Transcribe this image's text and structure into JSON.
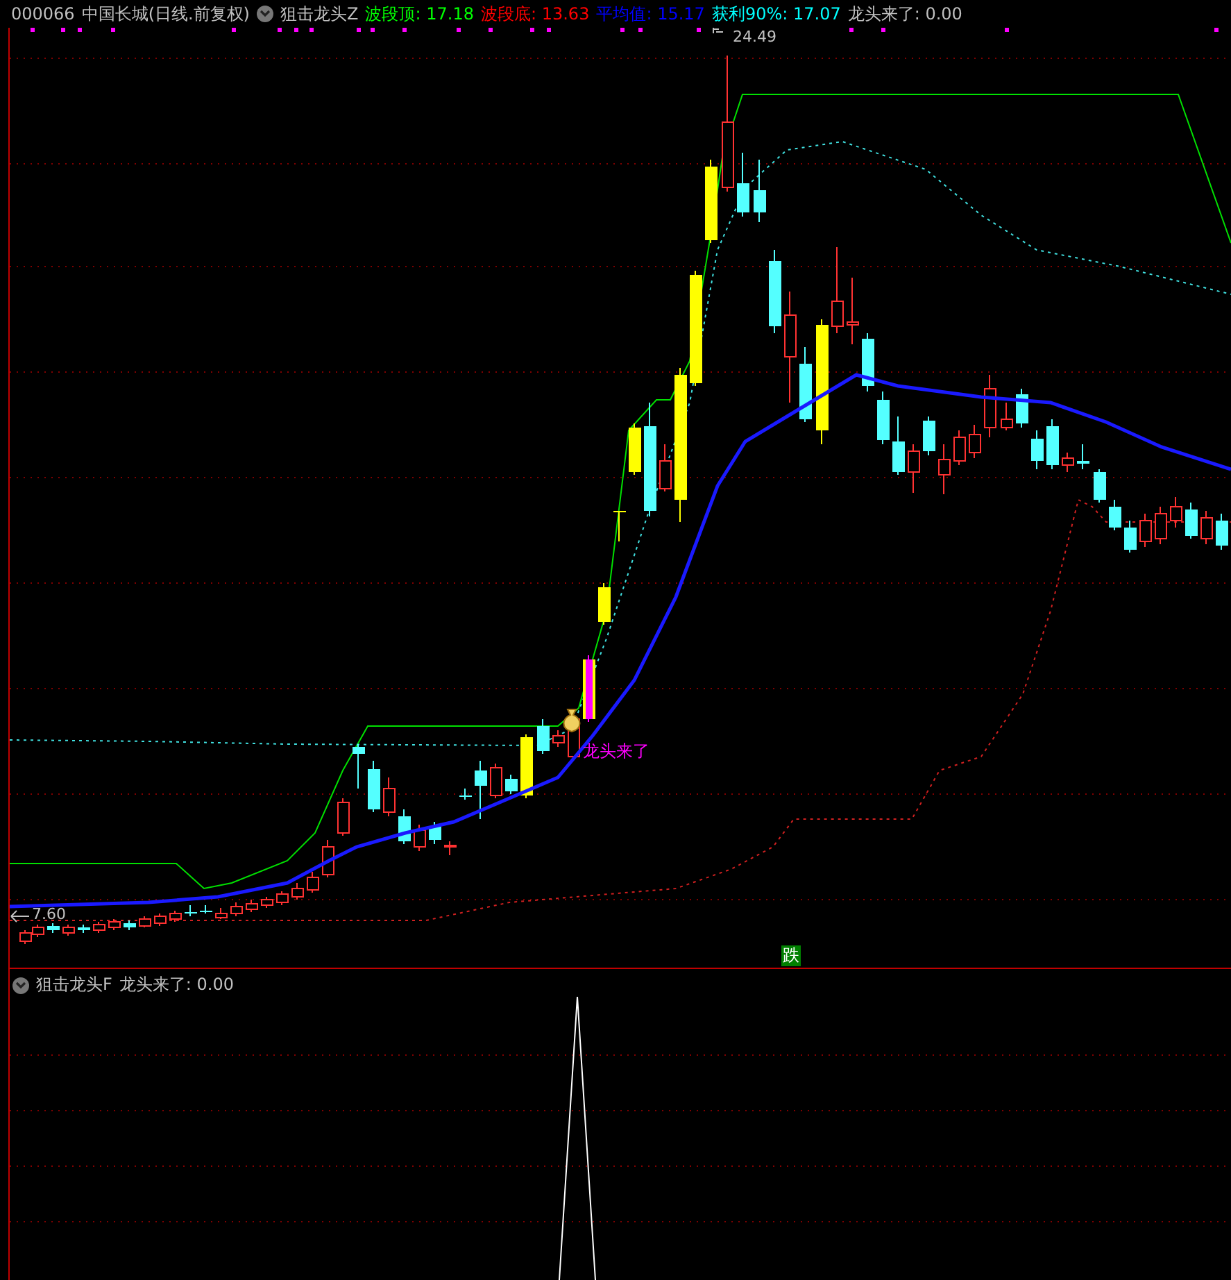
{
  "header": {
    "code": "000066",
    "name": "中国长城(日线.前复权)",
    "indicator": "狙击龙头Z",
    "values": [
      {
        "label": "波段顶:",
        "value": "17.18",
        "color": "#00ff00"
      },
      {
        "label": "波段底:",
        "value": "13.63",
        "color": "#ff0000"
      },
      {
        "label": "平均值:",
        "value": "15.17",
        "color": "#0000ff"
      },
      {
        "label": "获利90%:",
        "value": "17.07",
        "color": "#00ffff"
      },
      {
        "label": "龙头来了:",
        "value": "0.00",
        "color": "#c0c0c0"
      }
    ]
  },
  "main_chart": {
    "high_label": "24.49",
    "low_label": "7.60",
    "signal_label": "龙头来了",
    "marker": "跌"
  },
  "sub_panel": {
    "indicator": "狙击龙头F",
    "values": [
      {
        "label": "龙头来了:",
        "value": "0.00"
      }
    ]
  }
}
